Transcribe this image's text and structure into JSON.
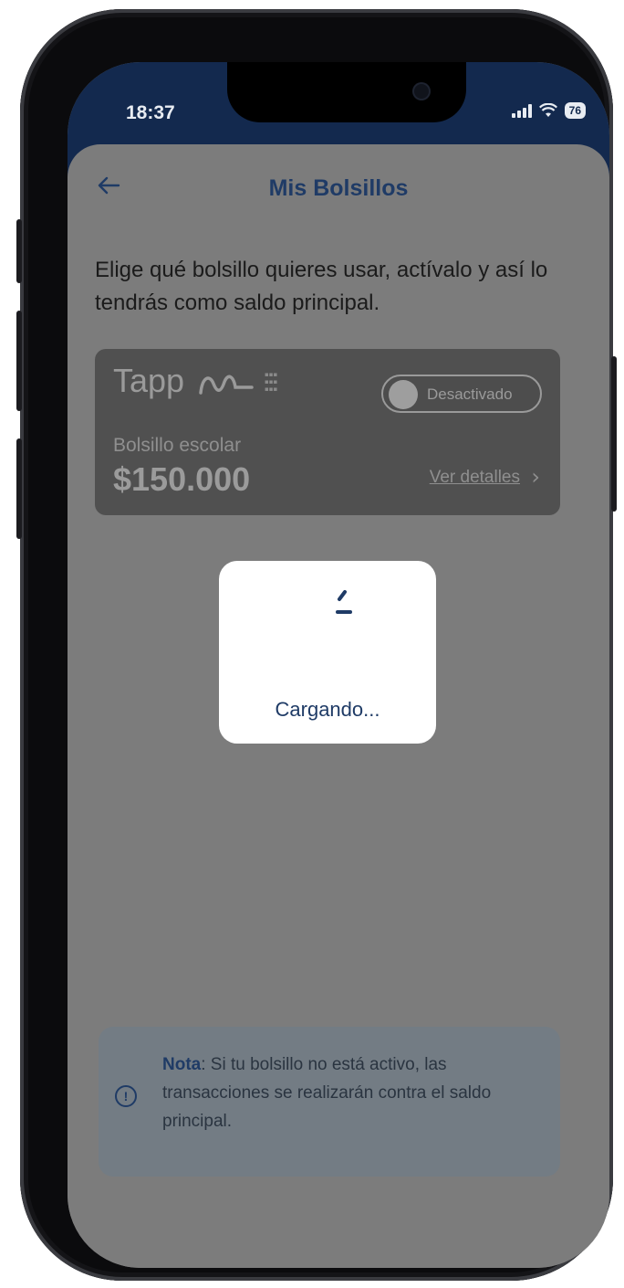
{
  "status_bar": {
    "time": "18:37",
    "battery": "76"
  },
  "header": {
    "title": "Mis Bolsillos",
    "back_icon": "arrow-left-icon"
  },
  "description": "Elige qué bolsillo quieres usar, actívalo y así lo tendrás como saldo principal.",
  "pocket_card": {
    "brand": "Tapp",
    "toggle_label": "Desactivado",
    "toggle_state": "off",
    "name": "Bolsillo escolar",
    "amount": "$150.000",
    "details_link": "Ver detalles",
    "details_icon": "chevron-right-icon"
  },
  "loading_dialog": {
    "text": "Cargando...",
    "icon": "spinner-icon"
  },
  "note": {
    "label": "Nota",
    "text": ": Si tu bolsillo no está activo, las transacciones se realizarán contra el saldo principal.",
    "icon": "info-icon"
  },
  "colors": {
    "primary": "#1f3b66",
    "status_bar_bg": "#13294e",
    "overlay_bg": "#7c7c7c"
  }
}
